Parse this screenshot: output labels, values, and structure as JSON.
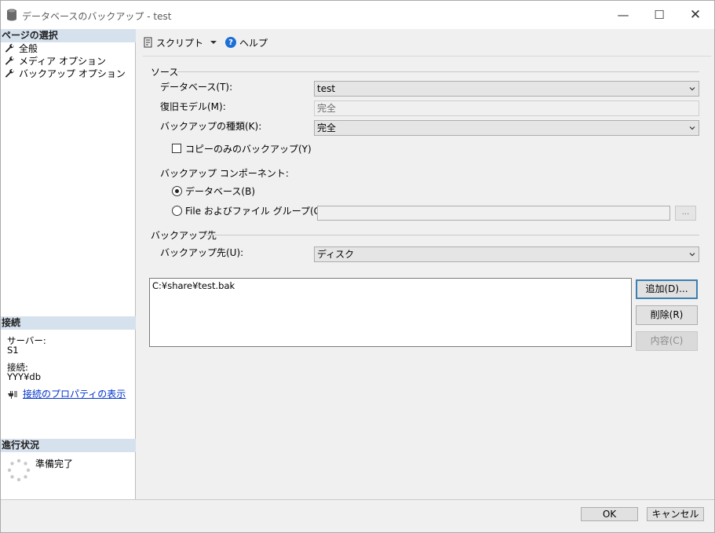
{
  "window": {
    "title": "データベースのバックアップ - test",
    "minimize_glyph": "—",
    "maximize_glyph": "☐",
    "close_glyph": "✕"
  },
  "left_panel": {
    "page_select_header": "ページの選択",
    "pages": [
      {
        "label": "全般",
        "icon": "wrench-icon"
      },
      {
        "label": "メディア オプション",
        "icon": "wrench-icon"
      },
      {
        "label": "バックアップ オプション",
        "icon": "wrench-icon"
      }
    ],
    "connection_header": "接続",
    "server_label": "サーバー:",
    "server_value": "S1",
    "connection_label": "接続:",
    "connection_value": "YYY¥db",
    "view_properties_link": "接続のプロパティの表示",
    "progress_header": "進行状況",
    "progress_status": "準備完了"
  },
  "toolbar": {
    "script_label": "スクリプト",
    "help_label": "ヘルプ"
  },
  "source": {
    "group_label": "ソース",
    "database_label": "データベース(T):",
    "database_value": "test",
    "recovery_model_label": "復旧モデル(M):",
    "recovery_model_value": "完全",
    "backup_type_label": "バックアップの種類(K):",
    "backup_type_value": "完全",
    "copy_only_label": "コピーのみのバックアップ(Y)",
    "copy_only_checked": false,
    "component_label": "バックアップ コンポーネント:",
    "component_database_label": "データベース(B)",
    "component_files_label": "File およびファイル グループ(G):",
    "selected_component": "database",
    "files_button_label": "..."
  },
  "destination": {
    "group_label": "バックアップ先",
    "backup_to_label": "バックアップ先(U):",
    "backup_to_value": "ディスク",
    "paths": [
      "C:¥share¥test.bak"
    ],
    "add_button": "追加(D)...",
    "remove_button": "削除(R)",
    "contents_button": "内容(C)"
  },
  "footer": {
    "ok_button": "OK",
    "cancel_button": "キャンセル"
  }
}
